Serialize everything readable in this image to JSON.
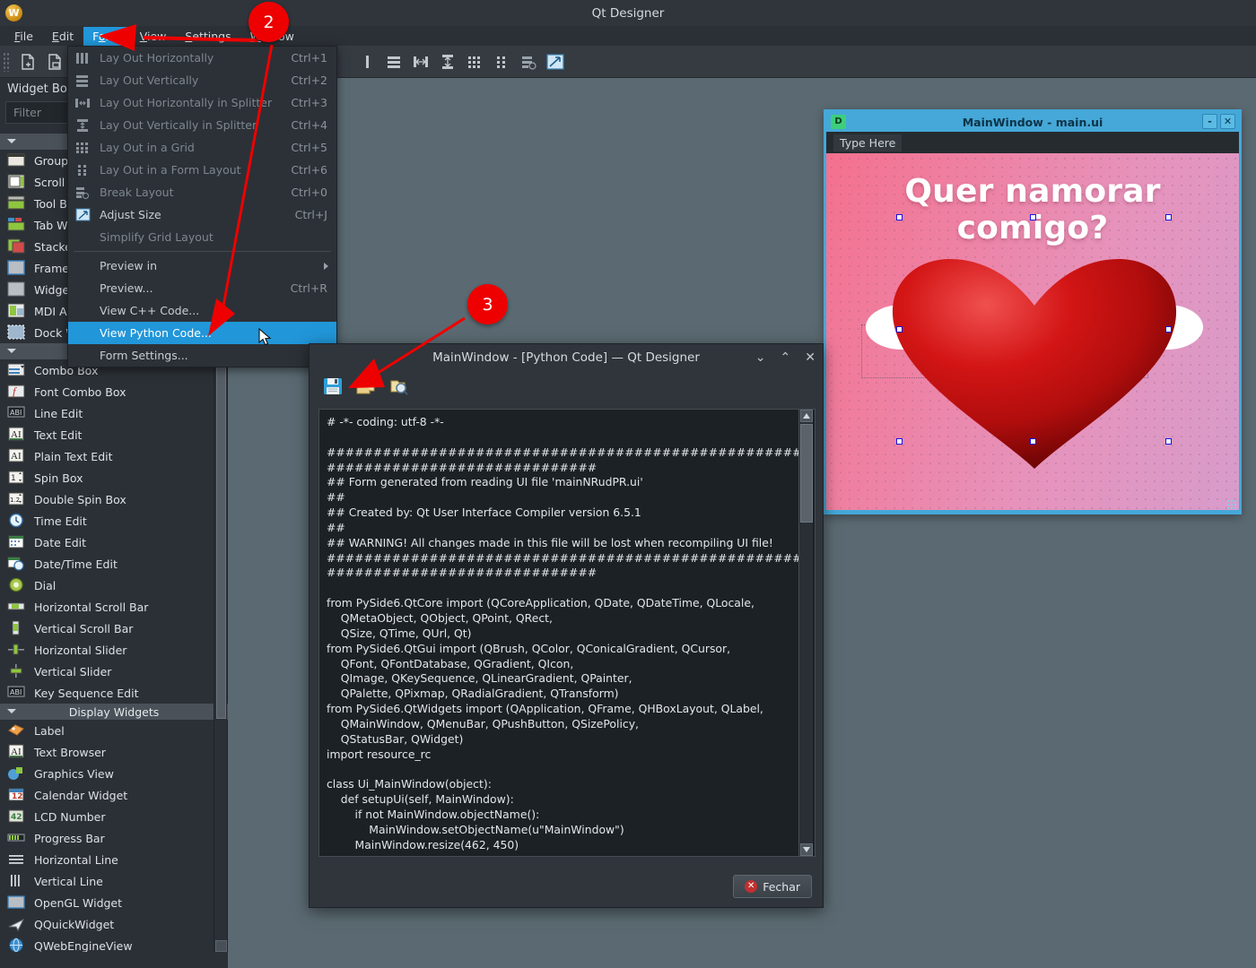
{
  "app": {
    "title": "Qt Designer",
    "logo_letter": "W"
  },
  "menubar": {
    "items": [
      {
        "label": "File",
        "accesskey": "F",
        "active": false
      },
      {
        "label": "Edit",
        "accesskey": "E",
        "active": false
      },
      {
        "label": "Form",
        "accesskey": "o",
        "active": true
      },
      {
        "label": "View",
        "accesskey": "V",
        "active": false
      },
      {
        "label": "Settings",
        "accesskey": "S",
        "active": false
      },
      {
        "label": "Window",
        "accesskey": "W",
        "active": false
      }
    ]
  },
  "toolbar": {
    "icons": [
      "new-form-icon",
      "open-form-icon",
      "lay-out-horizontally-icon",
      "lay-out-vertically-icon",
      "lay-out-horizontally-in-splitter-icon",
      "lay-out-vertically-in-splitter-icon",
      "lay-out-in-grid-icon",
      "lay-out-in-form-layout-icon",
      "break-layout-icon",
      "adjust-size-icon"
    ]
  },
  "form_menu": {
    "items": [
      {
        "label": "Lay Out Horizontally",
        "accesskey": "H",
        "shortcut": "Ctrl+1",
        "icon": "lay-out-horizontally-icon",
        "disabled": true,
        "selected": false
      },
      {
        "label": "Lay Out Vertically",
        "accesskey": "V",
        "shortcut": "Ctrl+2",
        "icon": "lay-out-vertically-icon",
        "disabled": true,
        "selected": false
      },
      {
        "label": "Lay Out Horizontally in Splitter",
        "accesskey": "S",
        "shortcut": "Ctrl+3",
        "icon": "splitter-horizontal-icon",
        "disabled": true,
        "selected": false
      },
      {
        "label": "Lay Out Vertically in Splitter",
        "accesskey": "l",
        "shortcut": "Ctrl+4",
        "icon": "splitter-vertical-icon",
        "disabled": true,
        "selected": false
      },
      {
        "label": "Lay Out in a Grid",
        "accesskey": "G",
        "shortcut": "Ctrl+5",
        "icon": "grid-layout-icon",
        "disabled": true,
        "selected": false
      },
      {
        "label": "Lay Out in a Form Layout",
        "accesskey": "F",
        "shortcut": "Ctrl+6",
        "icon": "form-layout-icon",
        "disabled": true,
        "selected": false
      },
      {
        "label": "Break Layout",
        "accesskey": "B",
        "shortcut": "Ctrl+0",
        "icon": "break-layout-icon",
        "disabled": true,
        "selected": false
      },
      {
        "label": "Adjust Size",
        "accesskey": "S",
        "shortcut": "Ctrl+J",
        "icon": "adjust-size-icon",
        "disabled": false,
        "selected": false
      },
      {
        "label": "Simplify Grid Layout",
        "accesskey": "m",
        "shortcut": "",
        "icon": "",
        "disabled": true,
        "selected": false
      },
      {
        "separator": true
      },
      {
        "label": "Preview in",
        "accesskey": "",
        "shortcut": "",
        "icon": "",
        "disabled": false,
        "selected": false,
        "submenu": true
      },
      {
        "label": "Preview...",
        "accesskey": "P",
        "shortcut": "Ctrl+R",
        "icon": "",
        "disabled": false,
        "selected": false
      },
      {
        "label": "View C++ Code...",
        "accesskey": "C",
        "shortcut": "",
        "icon": "",
        "disabled": false,
        "selected": false
      },
      {
        "label": "View Python Code...",
        "accesskey": "P",
        "shortcut": "",
        "icon": "",
        "disabled": false,
        "selected": true
      },
      {
        "label": "Form Settings...",
        "accesskey": "S",
        "shortcut": "",
        "icon": "",
        "disabled": false,
        "selected": false
      }
    ]
  },
  "widget_box": {
    "title": "Widget Box",
    "filter_placeholder": "Filter",
    "filter_value": "",
    "groups": [
      {
        "name": "",
        "items": [
          {
            "label": "Group Box",
            "icon": "group-box-icon"
          },
          {
            "label": "Scroll Area",
            "icon": "scroll-area-icon"
          },
          {
            "label": "Tool Box",
            "icon": "tool-box-icon"
          },
          {
            "label": "Tab Widget",
            "icon": "tab-widget-icon"
          },
          {
            "label": "Stacked Widget",
            "icon": "stacked-widget-icon"
          },
          {
            "label": "Frame",
            "icon": "frame-icon"
          },
          {
            "label": "Widget",
            "icon": "widget-icon"
          },
          {
            "label": "MDI Area",
            "icon": "mdi-area-icon"
          },
          {
            "label": "Dock Widget",
            "icon": "dock-widget-icon"
          }
        ]
      },
      {
        "name": "",
        "items": [
          {
            "label": "Combo Box",
            "icon": "combo-box-icon"
          },
          {
            "label": "Font Combo Box",
            "icon": "font-combo-box-icon"
          },
          {
            "label": "Line Edit",
            "icon": "line-edit-icon"
          },
          {
            "label": "Text Edit",
            "icon": "text-edit-icon"
          },
          {
            "label": "Plain Text Edit",
            "icon": "plain-text-edit-icon"
          },
          {
            "label": "Spin Box",
            "icon": "spin-box-icon"
          },
          {
            "label": "Double Spin Box",
            "icon": "double-spin-box-icon"
          },
          {
            "label": "Time Edit",
            "icon": "time-edit-icon"
          },
          {
            "label": "Date Edit",
            "icon": "date-edit-icon"
          },
          {
            "label": "Date/Time Edit",
            "icon": "date-time-edit-icon"
          },
          {
            "label": "Dial",
            "icon": "dial-icon"
          },
          {
            "label": "Horizontal Scroll Bar",
            "icon": "horizontal-scroll-bar-icon"
          },
          {
            "label": "Vertical Scroll Bar",
            "icon": "vertical-scroll-bar-icon"
          },
          {
            "label": "Horizontal Slider",
            "icon": "horizontal-slider-icon"
          },
          {
            "label": "Vertical Slider",
            "icon": "vertical-slider-icon"
          },
          {
            "label": "Key Sequence Edit",
            "icon": "key-sequence-edit-icon"
          }
        ]
      },
      {
        "name": "Display Widgets",
        "items": [
          {
            "label": "Label",
            "icon": "label-icon"
          },
          {
            "label": "Text Browser",
            "icon": "text-browser-icon"
          },
          {
            "label": "Graphics View",
            "icon": "graphics-view-icon"
          },
          {
            "label": "Calendar Widget",
            "icon": "calendar-widget-icon"
          },
          {
            "label": "LCD Number",
            "icon": "lcd-number-icon"
          },
          {
            "label": "Progress Bar",
            "icon": "progress-bar-icon"
          },
          {
            "label": "Horizontal Line",
            "icon": "horizontal-line-icon"
          },
          {
            "label": "Vertical Line",
            "icon": "vertical-line-icon"
          },
          {
            "label": "OpenGL Widget",
            "icon": "opengl-widget-icon"
          },
          {
            "label": "QQuickWidget",
            "icon": "qquickwidget-icon"
          },
          {
            "label": "QWebEngineView",
            "icon": "qwebengineview-icon"
          }
        ]
      }
    ]
  },
  "preview_window": {
    "title": "MainWindow - main.ui",
    "app_icon_letter": "D",
    "minimize_label": "-",
    "close_label": "✕",
    "menu_placeholder": "Type Here",
    "heading": "Quer namorar comigo?",
    "heart_icon": "heart-icon",
    "selection_handles": 8
  },
  "code_dialog": {
    "title": "MainWindow - [Python Code] — Qt Designer",
    "window_buttons": [
      "minimize-button",
      "maximize-button",
      "close-button"
    ],
    "toolbar_icons": [
      "save-icon",
      "copy-icon",
      "find-icon"
    ],
    "close_button_label": "Fechar",
    "close_button_icon": "close-circle-icon",
    "code": "# -*- coding: utf-8 -*-\n\n################################################################################\n## Form generated from reading UI file 'mainNRudPR.ui'\n##\n## Created by: Qt User Interface Compiler version 6.5.1\n##\n## WARNING! All changes made in this file will be lost when recompiling UI file!\n################################################################################\n\nfrom PySide6.QtCore import (QCoreApplication, QDate, QDateTime, QLocale,\n    QMetaObject, QObject, QPoint, QRect,\n    QSize, QTime, QUrl, Qt)\nfrom PySide6.QtGui import (QBrush, QColor, QConicalGradient, QCursor,\n    QFont, QFontDatabase, QGradient, QIcon,\n    QImage, QKeySequence, QLinearGradient, QPainter,\n    QPalette, QPixmap, QRadialGradient, QTransform)\nfrom PySide6.QtWidgets import (QApplication, QFrame, QHBoxLayout, QLabel,\n    QMainWindow, QMenuBar, QPushButton, QSizePolicy,\n    QStatusBar, QWidget)\nimport resource_rc\n\nclass Ui_MainWindow(object):\n    def setupUi(self, MainWindow):\n        if not MainWindow.objectName():\n            MainWindow.setObjectName(u\"MainWindow\")\n        MainWindow.resize(462, 450)"
  },
  "annotations": {
    "badges": [
      {
        "number": "2",
        "target": "form-menu"
      },
      {
        "number": "3",
        "target": "save-icon"
      }
    ],
    "color": "#ef0000"
  },
  "colors": {
    "accent": "#2196d9",
    "window_bg": "#2b3036",
    "canvas_bg": "#5b6a72",
    "preview_titlebar": "#45a8d8",
    "annotation_red": "#ef0000"
  }
}
